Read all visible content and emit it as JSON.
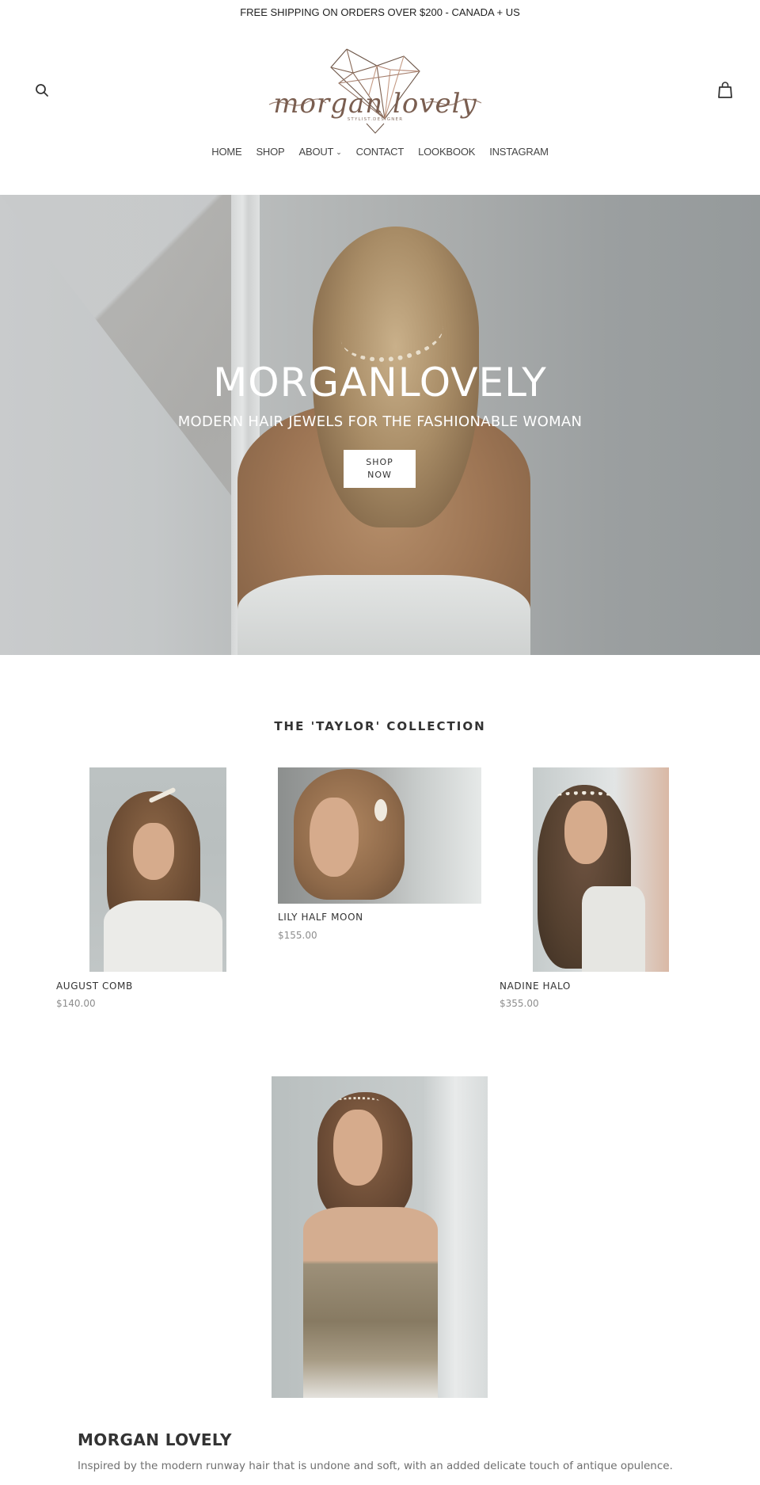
{
  "announcement": {
    "text": "FREE SHIPPING ON ORDERS OVER $200 - CANADA + US"
  },
  "header": {
    "search_icon": "search-icon",
    "cart_icon": "shopping-bag-icon",
    "logo": {
      "script_text": "morgan lovely",
      "tagline": "STYLIST.DESIGNER"
    }
  },
  "nav": {
    "items": [
      {
        "label": "HOME"
      },
      {
        "label": "SHOP"
      },
      {
        "label": "ABOUT",
        "has_dropdown": true,
        "chevron": "⌄"
      },
      {
        "label": "CONTACT"
      },
      {
        "label": "LOOKBOOK"
      },
      {
        "label": "INSTAGRAM"
      }
    ]
  },
  "hero": {
    "title": "MORGANLOVELY",
    "subtitle": "MODERN HAIR JEWELS FOR THE FASHIONABLE WOMAN",
    "button_line1": "SHOP",
    "button_line2": "NOW"
  },
  "collection": {
    "title": "THE 'TAYLOR' COLLECTION",
    "products": [
      {
        "name": "AUGUST COMB",
        "price": "$140.00"
      },
      {
        "name": "LILY HALF MOON",
        "price": "$155.00"
      },
      {
        "name": "NADINE HALO",
        "price": "$355.00"
      }
    ]
  },
  "about": {
    "title": "MORGAN LOVELY",
    "text": "Inspired by the modern runway hair that is undone and soft, with an added delicate touch of antique opulence."
  },
  "colors": {
    "text_dark": "#333333",
    "price_gray": "#8d8d8d",
    "logo_rose_gold": "#c49a84",
    "logo_bronze": "#6b5446"
  }
}
